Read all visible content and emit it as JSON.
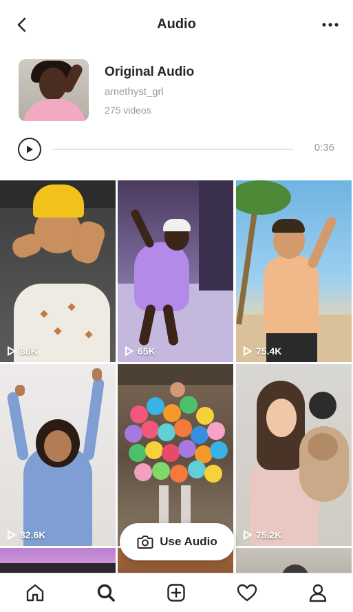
{
  "header": {
    "title": "Audio",
    "back_icon": "chevron-left-icon",
    "more_icon": "more-horizontal-icon"
  },
  "audio": {
    "title": "Original Audio",
    "username": "amethyst_grl",
    "video_count": "275 videos",
    "duration": "0:36",
    "progress": 0.0
  },
  "grid": {
    "tiles": [
      {
        "views": "86K"
      },
      {
        "views": "65K"
      },
      {
        "views": "75.4K"
      },
      {
        "views": "82.6K"
      },
      {
        "views": ""
      },
      {
        "views": "75.2K"
      }
    ]
  },
  "use_audio": {
    "label": "Use Audio",
    "icon": "camera-icon"
  },
  "tabbar": {
    "items": [
      "home-icon",
      "search-icon",
      "add-post-icon",
      "heart-icon",
      "profile-icon"
    ]
  },
  "colors": {
    "text_primary": "#262626",
    "text_secondary": "#9a9a9a",
    "background": "#ffffff"
  }
}
